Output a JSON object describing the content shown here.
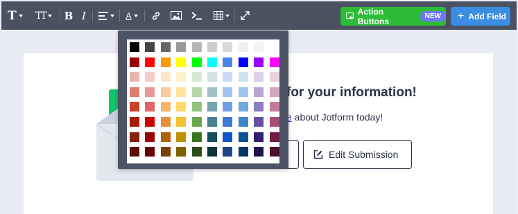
{
  "toolbar": {
    "icons": [
      "text-style-icon",
      "text-size-icon",
      "bold-icon",
      "italic-icon",
      "align-icon",
      "font-color-icon",
      "link-icon",
      "image-icon",
      "code-icon",
      "table-icon",
      "fullscreen-icon"
    ],
    "bold_glyph": "B",
    "italic_glyph": "I",
    "text_glyph": "T",
    "text_size_glyph": "TT",
    "color_glyph": "A",
    "action_buttons_label": "Action Buttons",
    "new_badge": "NEW",
    "add_field_label": "Add Field",
    "add_field_plus": "+",
    "colors": {
      "toolbar_bg": "#4a5262",
      "action_green": "#2ebd38",
      "badge_purple": "#6f76ff",
      "add_blue": "#3a8de0"
    }
  },
  "thank_you": {
    "title": "for your information!",
    "sub_link": "e",
    "sub_text": " about Jotform today!",
    "edit_submission_label": "Edit Submission"
  },
  "palette": {
    "colors": [
      [
        "#000000",
        "#434343",
        "#666666",
        "#999999",
        "#b7b7b7",
        "#cccccc",
        "#d9d9d9",
        "#efefef",
        "#f3f3f3",
        "#ffffff"
      ],
      [
        "#980000",
        "#ff0000",
        "#ff9900",
        "#ffff00",
        "#00ff00",
        "#00ffff",
        "#4a86e8",
        "#0000ff",
        "#9900ff",
        "#ff00ff"
      ],
      [
        "#e6b8af",
        "#f4cccc",
        "#fce5cd",
        "#fff2cc",
        "#d9ead3",
        "#d0e0e3",
        "#c9daf8",
        "#cfe2f3",
        "#d9d2e9",
        "#ead1dc"
      ],
      [
        "#dd7e6b",
        "#ea9999",
        "#f9cb9c",
        "#ffe599",
        "#b6d7a8",
        "#a2c4c9",
        "#a4c2f4",
        "#9fc5e8",
        "#b4a7d6",
        "#d5a6bd"
      ],
      [
        "#cc4125",
        "#e06666",
        "#f6b26b",
        "#ffd966",
        "#93c47d",
        "#76a5af",
        "#6d9eeb",
        "#6fa8dc",
        "#8e7cc3",
        "#c27ba0"
      ],
      [
        "#a61c00",
        "#cc0000",
        "#e69138",
        "#f1c232",
        "#6aa84f",
        "#45818e",
        "#3c78d8",
        "#3d85c6",
        "#674ea7",
        "#a64d79"
      ],
      [
        "#85200c",
        "#990000",
        "#b45f06",
        "#bf9000",
        "#38761d",
        "#134f5c",
        "#1155cc",
        "#0b5394",
        "#351c75",
        "#741b47"
      ],
      [
        "#5b0f00",
        "#660000",
        "#783f04",
        "#7f6000",
        "#274e13",
        "#0c343d",
        "#1c4587",
        "#073763",
        "#20124d",
        "#4c1130"
      ]
    ]
  }
}
